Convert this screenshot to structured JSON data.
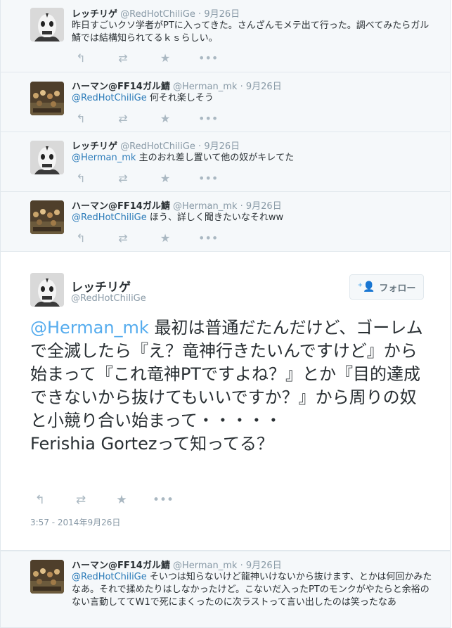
{
  "replies_above": [
    {
      "fullname": "レッチリゲ",
      "handle": "@RedHotChiliGe",
      "sep": "·",
      "time": "9月26日",
      "mention": "",
      "text": "昨日すごいクソ学者がPTに入ってきた。さんざんモメテ出て行った。調べてみたらガル鯖では結構知られてるｋｓらしい。",
      "avatar": "mask"
    },
    {
      "fullname": "ハーマン@FF14ガル鯖",
      "handle": "@Herman_mk",
      "sep": "·",
      "time": "9月26日",
      "mention": "@RedHotChiliGe",
      "text": " 何それ楽しそう",
      "avatar": "crowd"
    },
    {
      "fullname": "レッチリゲ",
      "handle": "@RedHotChiliGe",
      "sep": "·",
      "time": "9月26日",
      "mention": "@Herman_mk",
      "text": " 主のおれ差し置いて他の奴がキレてた",
      "avatar": "mask"
    },
    {
      "fullname": "ハーマン@FF14ガル鯖",
      "handle": "@Herman_mk",
      "sep": "·",
      "time": "9月26日",
      "mention": "@RedHotChiliGe",
      "text": " ほう、詳しく聞きたいなそれww",
      "avatar": "crowd"
    }
  ],
  "main_tweet": {
    "fullname": "レッチリゲ",
    "handle": "@RedHotChiliGe",
    "follow_label": "フォロー",
    "mention": "@Herman_mk",
    "text": " 最初は普通だたんだけど、ゴーレムで全滅したら『え？竜神行きたいんですけど』から始まって『これ竜神PTですよね？』とか『目的達成できないから抜けてもいいですか？』から周りの奴と小競り合い始まって・・・・・",
    "text_line2": "Ferishia Gortezって知ってる？",
    "timestamp": "3:57 - 2014年9月26日"
  },
  "reply_below": {
    "fullname": "ハーマン@FF14ガル鯖",
    "handle": "@Herman_mk",
    "sep": "·",
    "time": "9月26日",
    "mention": "@RedHotChiliGe",
    "text": " そいつは知らないけど龍神いけないから抜けます、とかは何回かみたなあ。それで揉めたりはしなかったけど。こないだ入ったPTのモンクがやたらと余裕のない言動しててW1で死にまくったのに次ラストって言い出したのは笑ったなあ"
  },
  "icons": {
    "reply": "reply-icon",
    "retweet": "retweet-icon",
    "favorite": "star-icon",
    "more": "more-icon",
    "follow": "add-user-icon"
  },
  "colors": {
    "mention": "#2b7bb9",
    "accent": "#55acee",
    "muted": "#8899a6",
    "conversation_bg": "#f5f8fa"
  }
}
